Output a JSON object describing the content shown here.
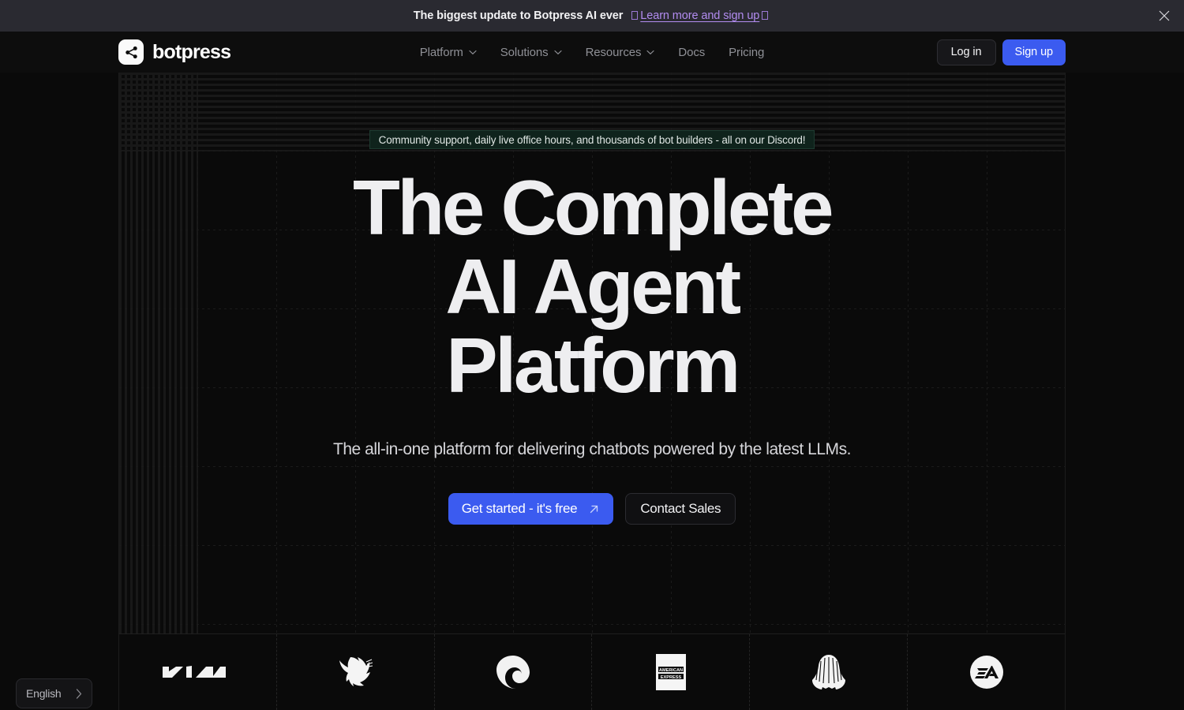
{
  "banner": {
    "text": "The biggest update to Botpress AI ever",
    "link_label": "Learn more and sign up",
    "close_icon": "close-icon"
  },
  "navbar": {
    "brand": "botpress",
    "brand_icon": "share-nodes-icon",
    "links": [
      {
        "label": "Platform",
        "has_chevron": true
      },
      {
        "label": "Solutions",
        "has_chevron": true
      },
      {
        "label": "Resources",
        "has_chevron": true
      },
      {
        "label": "Docs",
        "has_chevron": false
      },
      {
        "label": "Pricing",
        "has_chevron": false
      }
    ],
    "login_label": "Log in",
    "signup_label": "Sign up"
  },
  "hero": {
    "pill": "Community support, daily live office hours, and thousands of bot builders - all on our Discord!",
    "title_line1": "The Complete",
    "title_line2": "AI Agent",
    "title_line3": "Platform",
    "subtitle": "The all-in-one platform for delivering chatbots powered by the latest LLMs.",
    "primary_cta": "Get started - it's free",
    "primary_cta_icon": "arrow-up-right-icon",
    "secondary_cta": "Contact Sales"
  },
  "logos": [
    {
      "name": "kia",
      "label": "KIA"
    },
    {
      "name": "eagle",
      "label": "Eagle"
    },
    {
      "name": "swirl",
      "label": "Swirl"
    },
    {
      "name": "american-express",
      "label": "AMERICAN EXPRESS",
      "label_line1": "AMERICAN",
      "label_line2": "EXPRESS"
    },
    {
      "name": "shell",
      "label": "Shell"
    },
    {
      "name": "ea",
      "label": "EA"
    }
  ],
  "language_selector": {
    "label": "English",
    "icon": "chevron-right-icon"
  },
  "colors": {
    "accent_blue": "#3b5bf0",
    "banner_bg": "#2a2a31",
    "banner_link": "#b28cf0",
    "pill_bg": "#0f231c",
    "page_bg": "#0a0a0a"
  }
}
